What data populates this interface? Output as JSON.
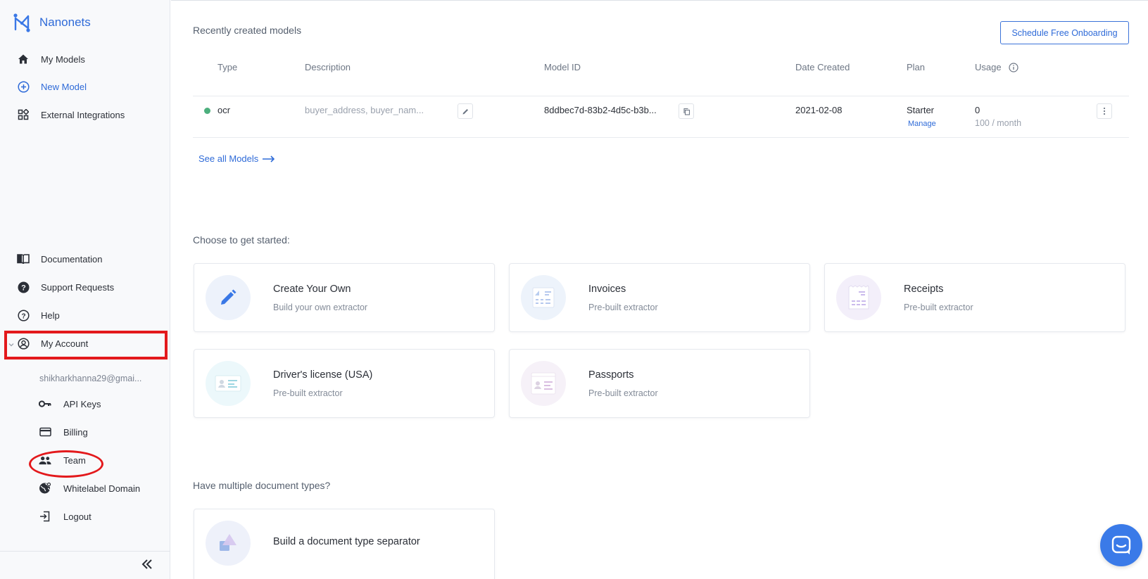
{
  "brand": {
    "name": "Nanonets"
  },
  "sidebar": {
    "top_items": [
      {
        "label": "My Models",
        "icon": "home-icon"
      },
      {
        "label": "New Model",
        "icon": "plus-circle-icon",
        "active": true
      },
      {
        "label": "External Integrations",
        "icon": "integrations-icon"
      }
    ],
    "bottom_items": [
      {
        "label": "Documentation",
        "icon": "book-icon"
      },
      {
        "label": "Support Requests",
        "icon": "help-circle-icon"
      },
      {
        "label": "Help",
        "icon": "question-icon"
      },
      {
        "label": "My Account",
        "icon": "account-icon"
      }
    ],
    "account": {
      "email": "shikharkhanna29@gmai...",
      "items": [
        {
          "label": "API Keys",
          "icon": "key-icon"
        },
        {
          "label": "Billing",
          "icon": "credit-card-icon"
        },
        {
          "label": "Team",
          "icon": "team-icon"
        },
        {
          "label": "Whitelabel Domain",
          "icon": "globe-icon"
        },
        {
          "label": "Logout",
          "icon": "logout-icon"
        }
      ]
    }
  },
  "main": {
    "recent_title": "Recently created models",
    "onboarding_button": "Schedule Free Onboarding",
    "table": {
      "headers": {
        "type": "Type",
        "description": "Description",
        "model_id": "Model ID",
        "date_created": "Date Created",
        "plan": "Plan",
        "usage": "Usage"
      },
      "row": {
        "type": "ocr",
        "description": "buyer_address, buyer_nam...",
        "model_id": "8ddbec7d-83b2-4d5c-b3b...",
        "date_created": "2021-02-08",
        "plan": "Starter",
        "plan_link": "Manage",
        "usage": "0",
        "usage_limit": "100 / month"
      }
    },
    "see_all": "See all Models",
    "get_started_title": "Choose to get started:",
    "cards": [
      {
        "title": "Create Your Own",
        "subtitle": "Build your own extractor"
      },
      {
        "title": "Invoices",
        "subtitle": "Pre-built extractor"
      },
      {
        "title": "Receipts",
        "subtitle": "Pre-built extractor"
      },
      {
        "title": "Driver's license (USA)",
        "subtitle": "Pre-built extractor"
      },
      {
        "title": "Passports",
        "subtitle": "Pre-built extractor"
      }
    ],
    "multi_title": "Have multiple document types?",
    "separator_card": {
      "title": "Build a document type separator"
    }
  },
  "colors": {
    "accent": "#2f6bd8",
    "highlight": "#e3191c",
    "status_ok": "#4caf7d"
  }
}
